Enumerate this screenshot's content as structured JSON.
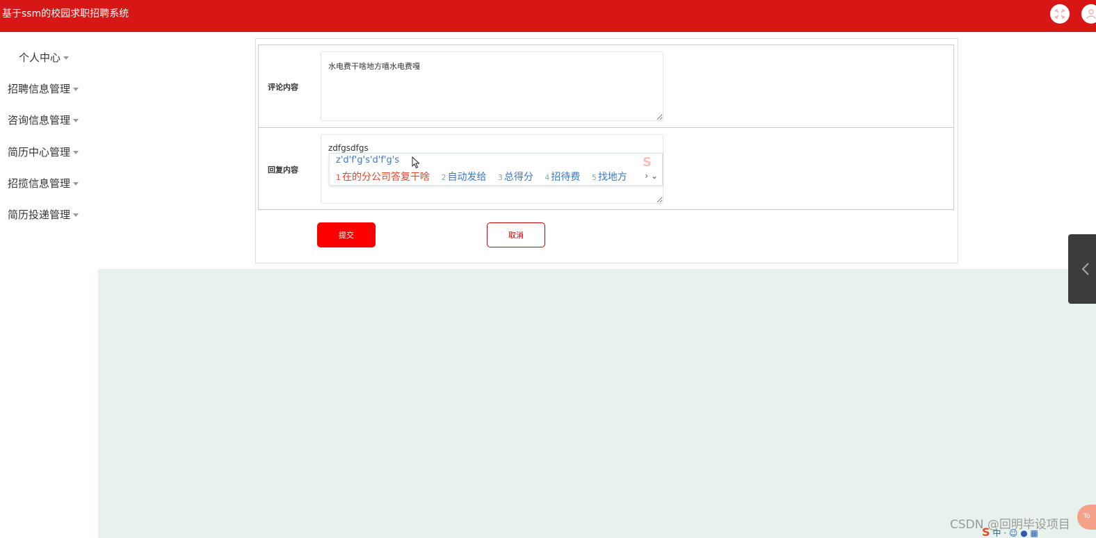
{
  "header": {
    "title": "基于ssm的校园求职招聘系统",
    "bg_color": "#d71716"
  },
  "sidebar": {
    "items": [
      {
        "label": "个人中心"
      },
      {
        "label": "招聘信息管理"
      },
      {
        "label": "咨询信息管理"
      },
      {
        "label": "简历中心管理"
      },
      {
        "label": "招揽信息管理"
      },
      {
        "label": "简历投递管理"
      }
    ]
  },
  "form": {
    "comment_label": "评论内容",
    "comment_value": "水电费干啥地方嘻水电费嘎",
    "reply_label": "回复内容",
    "reply_value": "zdfgsdfgs",
    "submit_label": "提交",
    "cancel_label": "取消",
    "submit_color": "#fa0000"
  },
  "ime": {
    "composition": "z'd'f'g's'd'f'g's",
    "candidates": [
      {
        "num": "1",
        "text": "在的分公司答复干啥"
      },
      {
        "num": "2",
        "text": "自动发给"
      },
      {
        "num": "3",
        "text": "总得分"
      },
      {
        "num": "4",
        "text": "招待费"
      },
      {
        "num": "5",
        "text": "找地方"
      }
    ],
    "logo": "S"
  },
  "overlay": {
    "watermark": "CSDN @回明毕设项目",
    "top_button": "To",
    "tray_logo": "S",
    "tray_text": "中"
  }
}
